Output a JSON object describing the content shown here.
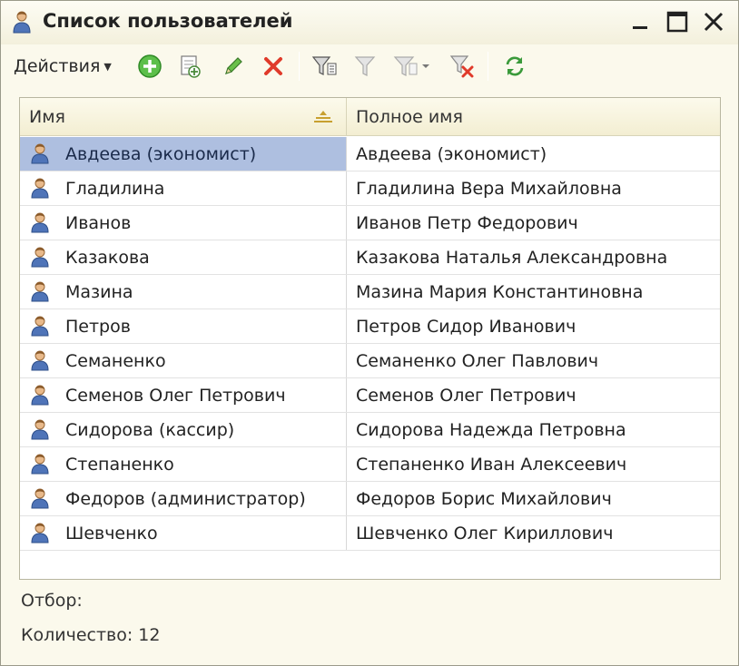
{
  "window": {
    "title": "Список пользователей",
    "icon": "user-icon"
  },
  "toolbar": {
    "actions_label": "Действия",
    "buttons": [
      {
        "name": "add-icon"
      },
      {
        "name": "copy-icon"
      },
      {
        "name": "edit-icon"
      },
      {
        "name": "delete-icon"
      },
      {
        "name": "filter-by-value-icon"
      },
      {
        "name": "filter-icon"
      },
      {
        "name": "filter-dropdown-icon"
      },
      {
        "name": "clear-filter-icon"
      },
      {
        "name": "refresh-icon"
      }
    ]
  },
  "table": {
    "columns": {
      "name": "Имя",
      "full_name": "Полное имя"
    },
    "rows": [
      {
        "name": "Авдеева (экономист)",
        "full_name": "Авдеева (экономист)",
        "selected": true
      },
      {
        "name": "Гладилина",
        "full_name": "Гладилина Вера Михайловна"
      },
      {
        "name": "Иванов",
        "full_name": "Иванов Петр Федорович"
      },
      {
        "name": "Казакова",
        "full_name": "Казакова Наталья Александровна"
      },
      {
        "name": "Мазина",
        "full_name": "Мазина Мария Константиновна"
      },
      {
        "name": "Петров",
        "full_name": "Петров Сидор Иванович"
      },
      {
        "name": "Семаненко",
        "full_name": "Семаненко Олег Павлович"
      },
      {
        "name": "Семенов Олег Петрович",
        "full_name": "Семенов Олег Петрович"
      },
      {
        "name": "Сидорова (кассир)",
        "full_name": "Сидорова Надежда Петровна"
      },
      {
        "name": "Степаненко",
        "full_name": "Степаненко Иван Алексеевич"
      },
      {
        "name": "Федоров (администратор)",
        "full_name": "Федоров Борис Михайлович"
      },
      {
        "name": "Шевченко",
        "full_name": "Шевченко Олег Кириллович"
      }
    ]
  },
  "footer": {
    "filter_label": "Отбор:",
    "count_label": "Количество: 12"
  },
  "colors": {
    "selection": "#aebfe0",
    "window_bg": "#fbf9ec"
  }
}
